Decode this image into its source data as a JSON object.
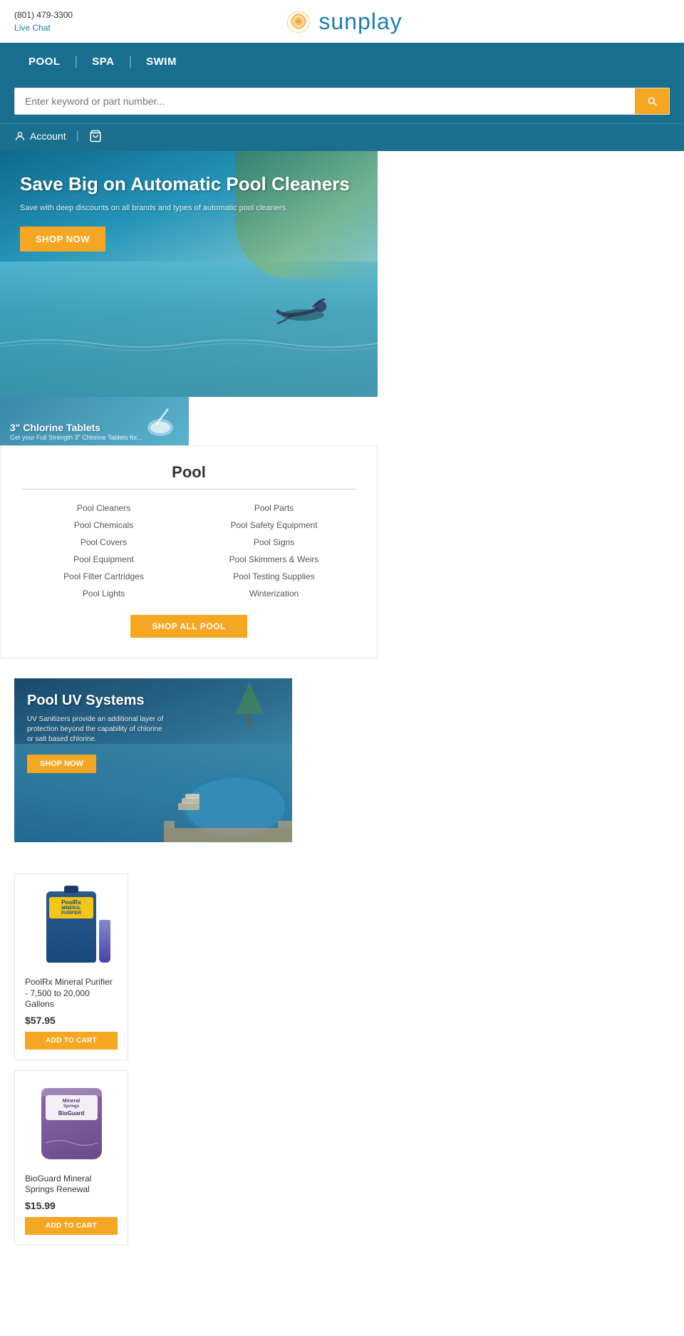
{
  "brand": {
    "phone": "(801) 479-3300",
    "live_chat": "Live Chat",
    "logo_symbol": "●",
    "logo_name": "sunplay"
  },
  "nav": {
    "items": [
      "POOL",
      "SPA",
      "SWIM"
    ]
  },
  "search": {
    "placeholder": "Enter keyword or part number..."
  },
  "account": {
    "label": "Account"
  },
  "hero": {
    "title": "Save Big on Automatic Pool Cleaners",
    "subtitle": "Save with deep discounts on all brands and types of automatic pool cleaners.",
    "cta": "SHOP NOW"
  },
  "chlorine_mini": {
    "title": "3\" Chlorine Tablets",
    "subtitle": "Get your Full Strength 3\" Chlorine Tablets for..."
  },
  "pool_section": {
    "heading": "Pool",
    "links": [
      "Pool Cleaners",
      "Pool Parts",
      "Pool Chemicals",
      "Pool Safety Equipment",
      "Pool Covers",
      "Pool Signs",
      "Pool Equipment",
      "Pool Skimmers & Weirs",
      "Pool Filter Cartridges",
      "Pool Testing Supplies",
      "Pool Lights",
      "Winterization"
    ],
    "cta": "SHOP ALL POOL"
  },
  "uv_banner": {
    "title": "Pool UV Systems",
    "subtitle": "UV Sanitizers provide an additional layer of protection beyond the capability of chlorine or salt based chlorine.",
    "cta": "SHOP NOW"
  },
  "products": [
    {
      "name": "PoolRx Mineral Purifier - 7,500 to 20,000 Gallons",
      "price": "$57.95",
      "cta": "ADD TO CART",
      "type": "poolrx"
    },
    {
      "name": "BioGuard Mineral Springs Renewal",
      "price": "$15.99",
      "cta": "ADD TO CART",
      "type": "bioguard"
    }
  ]
}
